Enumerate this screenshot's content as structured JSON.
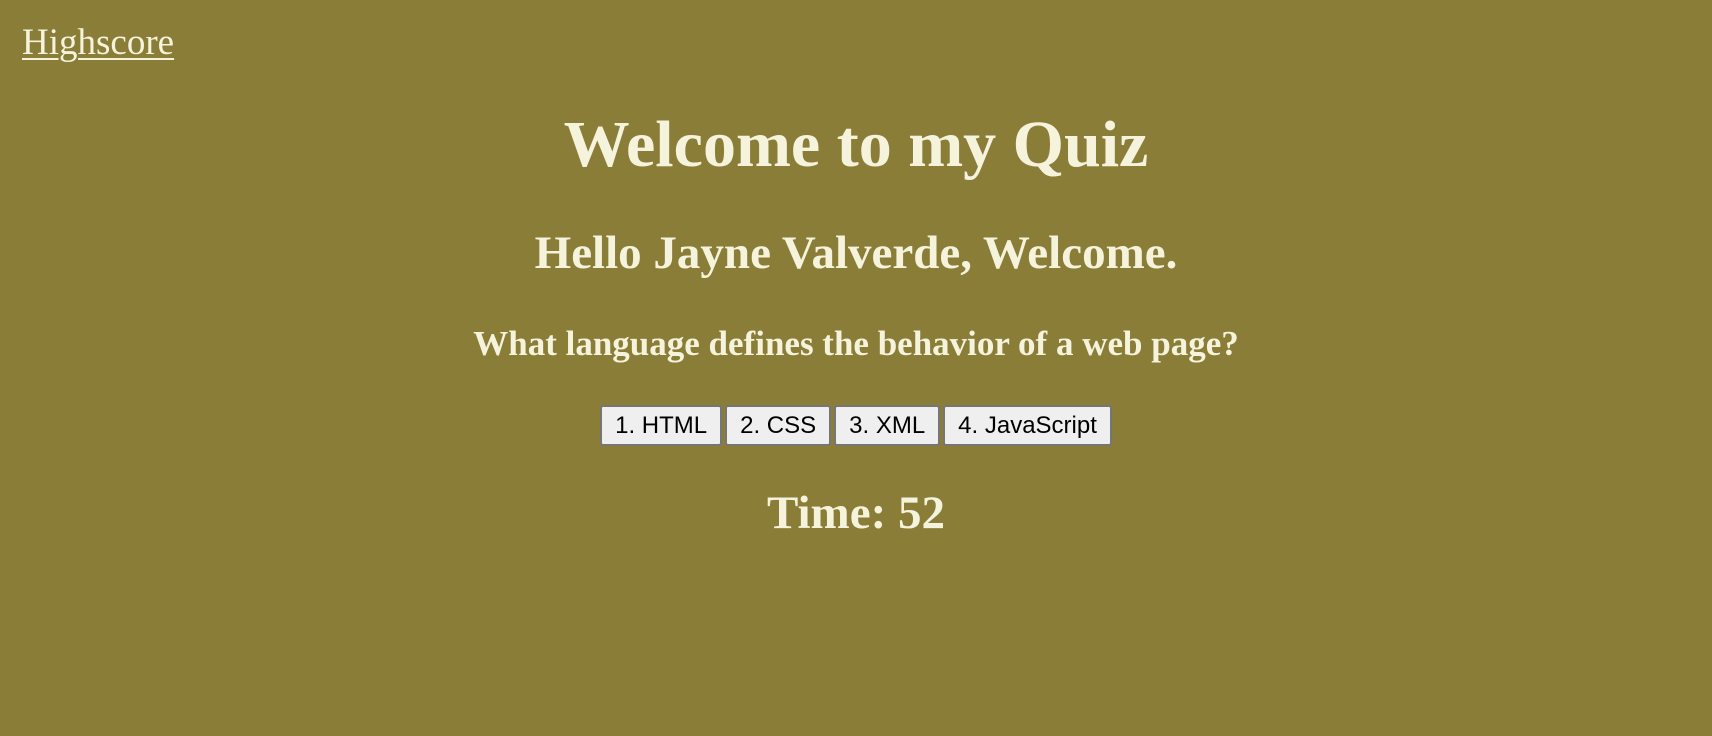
{
  "nav": {
    "highscore_label": "Highscore"
  },
  "quiz": {
    "title": "Welcome to my Quiz",
    "greeting": "Hello Jayne Valverde, Welcome.",
    "question": "What language defines the behavior of a web page?",
    "answers": [
      {
        "label": "1. HTML"
      },
      {
        "label": "2. CSS"
      },
      {
        "label": "3. XML"
      },
      {
        "label": "4. JavaScript"
      }
    ],
    "timer": "Time: 52"
  },
  "colors": {
    "background": "#8a7d38",
    "text": "#f5f3dc",
    "button_bg": "#efefef",
    "button_border": "#767676"
  }
}
